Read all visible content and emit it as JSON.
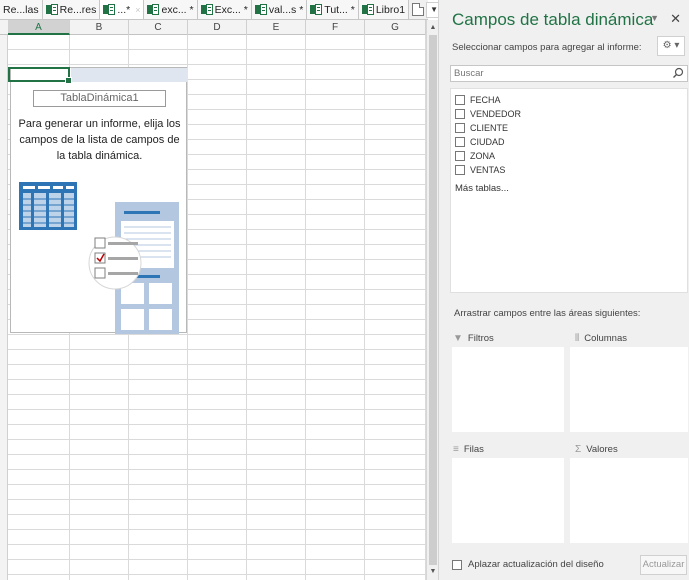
{
  "tabs": [
    {
      "label": "Re...las",
      "has_icon": false,
      "active": false
    },
    {
      "label": "Re...res",
      "has_icon": true,
      "active": false
    },
    {
      "label": "...*",
      "has_icon": true,
      "active": true
    },
    {
      "label": "exc... *",
      "has_icon": true,
      "active": false
    },
    {
      "label": "Exc... *",
      "has_icon": true,
      "active": false
    },
    {
      "label": "val...s *",
      "has_icon": true,
      "active": false
    },
    {
      "label": "Tut... *",
      "has_icon": true,
      "active": false
    },
    {
      "label": "Libro1",
      "has_icon": true,
      "active": false
    }
  ],
  "tab_close_glyph": "×",
  "window_close_glyph": "×",
  "columns": [
    "A",
    "B",
    "C",
    "D",
    "E",
    "F",
    "G"
  ],
  "selected_column": "A",
  "pivot": {
    "name": "TablaDinámica1",
    "instructions": "Para generar un informe, elija los campos de la lista de campos de la tabla dinámica."
  },
  "pane": {
    "title": "Campos de tabla dinámica",
    "subtitle": "Seleccionar campos para agregar al informe:",
    "search_placeholder": "Buscar",
    "fields": [
      "FECHA",
      "VENDEDOR",
      "CLIENTE",
      "CIUDAD",
      "ZONA",
      "VENTAS"
    ],
    "more_tables": "Más tablas...",
    "drag_label": "Arrastrar campos entre las áreas siguientes:",
    "areas": {
      "filters": "Filtros",
      "columns": "Columnas",
      "rows": "Filas",
      "values": "Valores"
    },
    "defer_label": "Aplazar actualización del diseño",
    "update_button": "Actualizar"
  },
  "colors": {
    "excel_green": "#217346",
    "grid_line": "#dadada",
    "pane_bg": "#f0f0f0"
  }
}
